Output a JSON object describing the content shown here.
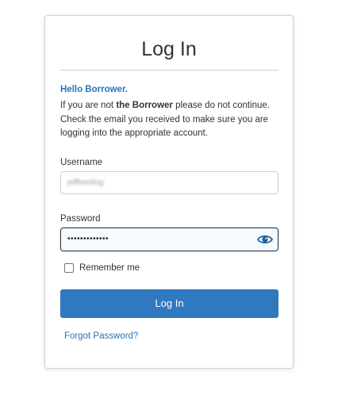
{
  "login": {
    "title": "Log In",
    "greeting": "Hello Borrower.",
    "intro_prefix": "If you are not ",
    "intro_bold": "the Borrower",
    "intro_suffix": " please do not continue. Check the email you received to make sure you are logging into the appropriate account.",
    "username_label": "Username",
    "username_value": "jeffbeeling",
    "password_label": "Password",
    "password_value": "•••••••••••••",
    "password_toggle_icon": "eye-icon",
    "remember_label": "Remember me",
    "remember_checked": false,
    "submit_label": "Log In",
    "forgot_label": "Forgot Password?"
  },
  "colors": {
    "accent": "#3079c0",
    "link": "#2a72b8",
    "text": "#333333",
    "border": "#cfcfcf",
    "focus_border": "#2b3a4a",
    "focus_bg": "#f5faff"
  }
}
